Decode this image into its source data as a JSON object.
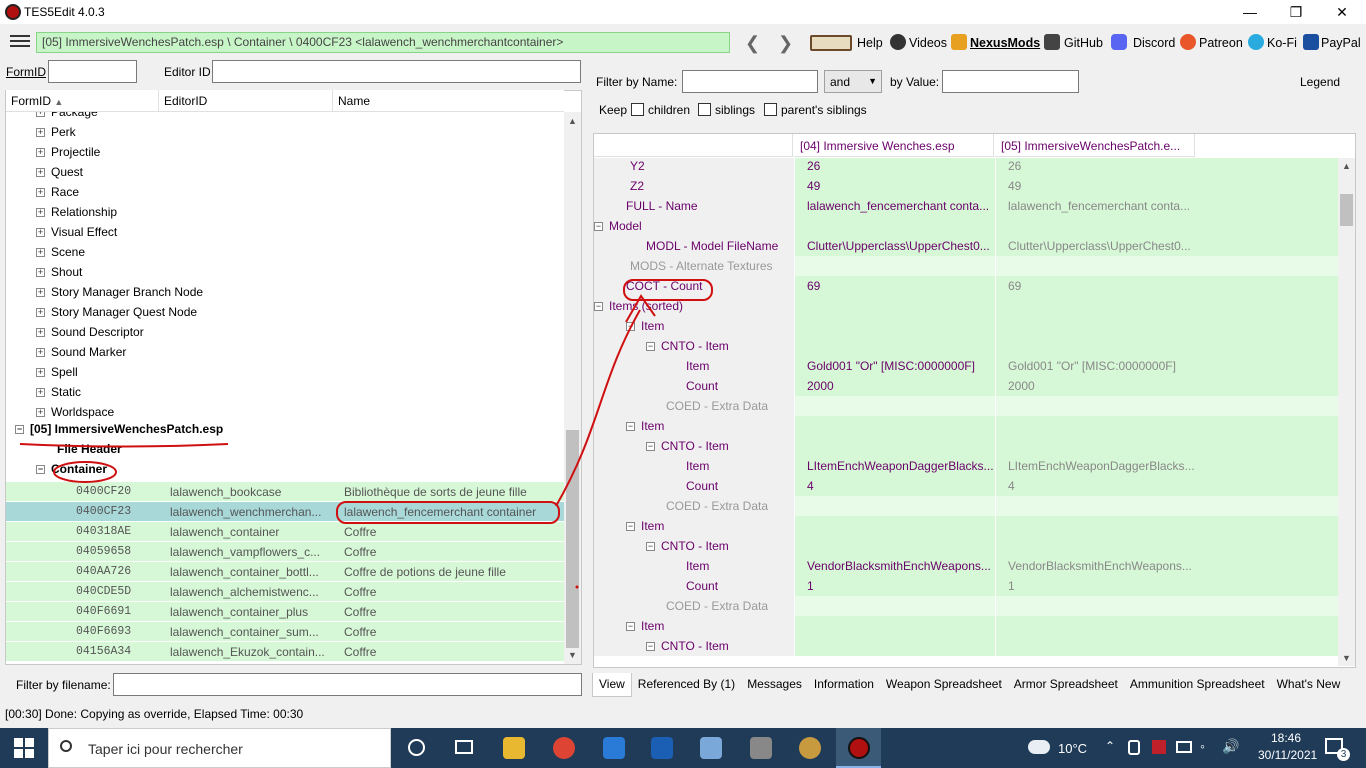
{
  "window": {
    "title": "TES5Edit 4.0.3"
  },
  "toolbar": {
    "path": "[05] ImmersiveWenchesPatch.esp \\ Container \\ 0400CF23 <lalawench_wenchmerchantcontainer>",
    "links": [
      "Help",
      "Videos",
      "NexusMods",
      "GitHub",
      "Discord",
      "Patreon",
      "Ko-Fi",
      "PayPal"
    ]
  },
  "left": {
    "formid_label": "FormID",
    "editorid_label": "Editor ID",
    "formid_value": "",
    "editorid_value": "",
    "columns": [
      "FormID",
      "EditorID",
      "Name"
    ],
    "tree_top": [
      "Package",
      "Perk",
      "Projectile",
      "Quest",
      "Race",
      "Relationship",
      "Visual Effect",
      "Scene",
      "Shout",
      "Story Manager Branch Node",
      "Story Manager Quest Node",
      "Sound Descriptor",
      "Sound Marker",
      "Spell",
      "Static",
      "Worldspace"
    ],
    "plugin": "[05] ImmersiveWenchesPatch.esp",
    "file_header": "File Header",
    "container": "Container",
    "records": [
      {
        "formid": "0400CF20",
        "editorid": "lalawench_bookcase",
        "name": "Bibliothèque de sorts de jeune fille"
      },
      {
        "formid": "0400CF23",
        "editorid": "lalawench_wenchmerchan...",
        "name": "lalawench_fencemerchant container"
      },
      {
        "formid": "040318AE",
        "editorid": "lalawench_container",
        "name": "Coffre"
      },
      {
        "formid": "04059658",
        "editorid": "lalawench_vampflowers_c...",
        "name": "Coffre"
      },
      {
        "formid": "040AA726",
        "editorid": "lalawench_container_bottl...",
        "name": "Coffre de potions de jeune fille"
      },
      {
        "formid": "040CDE5D",
        "editorid": "lalawench_alchemistwenc...",
        "name": "Coffre"
      },
      {
        "formid": "040F6691",
        "editorid": "lalawench_container_plus",
        "name": "Coffre"
      },
      {
        "formid": "040F6693",
        "editorid": "lalawench_container_sum...",
        "name": "Coffre"
      },
      {
        "formid": "04156A34",
        "editorid": "lalawench_Ekuzok_contain...",
        "name": "Coffre"
      }
    ],
    "filter_filename_label": "Filter by filename:"
  },
  "right": {
    "filter_name_label": "Filter by Name:",
    "and_value": "and",
    "by_value_label": "by Value:",
    "legend": "Legend",
    "keep_label": "Keep",
    "children": "children",
    "siblings": "siblings",
    "parents_siblings": "parent's siblings",
    "col1": "[04] Immersive Wenches.esp",
    "col2": "[05] ImmersiveWenchesPatch.e...",
    "rows": [
      {
        "label": "Y2",
        "v1": "26",
        "v2": "26"
      },
      {
        "label": "Z2",
        "v1": "49",
        "v2": "49"
      },
      {
        "label": "FULL - Name",
        "v1": "lalawench_fencemerchant conta...",
        "v2": "lalawench_fencemerchant conta..."
      },
      {
        "label": "Model",
        "v1": "",
        "v2": ""
      },
      {
        "label": "MODL - Model FileName",
        "v1": "Clutter\\Upperclass\\UpperChest0...",
        "v2": "Clutter\\Upperclass\\UpperChest0..."
      },
      {
        "label": "MODS - Alternate Textures",
        "v1": "",
        "v2": ""
      },
      {
        "label": "COCT - Count",
        "v1": "69",
        "v2": "69"
      },
      {
        "label": "Items (sorted)",
        "v1": "",
        "v2": ""
      },
      {
        "label": "Item",
        "v1": "",
        "v2": ""
      },
      {
        "label": "CNTO - Item",
        "v1": "",
        "v2": ""
      },
      {
        "label": "Item",
        "v1": "Gold001 \"Or\" [MISC:0000000F]",
        "v2": "Gold001 \"Or\" [MISC:0000000F]"
      },
      {
        "label": "Count",
        "v1": "2000",
        "v2": "2000"
      },
      {
        "label": "COED - Extra Data",
        "v1": "",
        "v2": ""
      },
      {
        "label": "Item",
        "v1": "",
        "v2": ""
      },
      {
        "label": "CNTO - Item",
        "v1": "",
        "v2": ""
      },
      {
        "label": "Item",
        "v1": "LItemEnchWeaponDaggerBlacks...",
        "v2": "LItemEnchWeaponDaggerBlacks..."
      },
      {
        "label": "Count",
        "v1": "4",
        "v2": "4"
      },
      {
        "label": "COED - Extra Data",
        "v1": "",
        "v2": ""
      },
      {
        "label": "Item",
        "v1": "",
        "v2": ""
      },
      {
        "label": "CNTO - Item",
        "v1": "",
        "v2": ""
      },
      {
        "label": "Item",
        "v1": "VendorBlacksmithEnchWeapons...",
        "v2": "VendorBlacksmithEnchWeapons..."
      },
      {
        "label": "Count",
        "v1": "1",
        "v2": "1"
      },
      {
        "label": "COED - Extra Data",
        "v1": "",
        "v2": ""
      },
      {
        "label": "Item",
        "v1": "",
        "v2": ""
      },
      {
        "label": "CNTO - Item",
        "v1": "",
        "v2": ""
      }
    ],
    "tabs": [
      "View",
      "Referenced By (1)",
      "Messages",
      "Information",
      "Weapon Spreadsheet",
      "Armor Spreadsheet",
      "Ammunition Spreadsheet",
      "What's New"
    ]
  },
  "status": "[00:30] Done: Copying as override, Elapsed Time: 00:30",
  "taskbar": {
    "search_placeholder": "Taper ici pour rechercher",
    "temperature": "10°C",
    "time": "18:46",
    "date": "30/11/2021",
    "notifications": "3"
  }
}
